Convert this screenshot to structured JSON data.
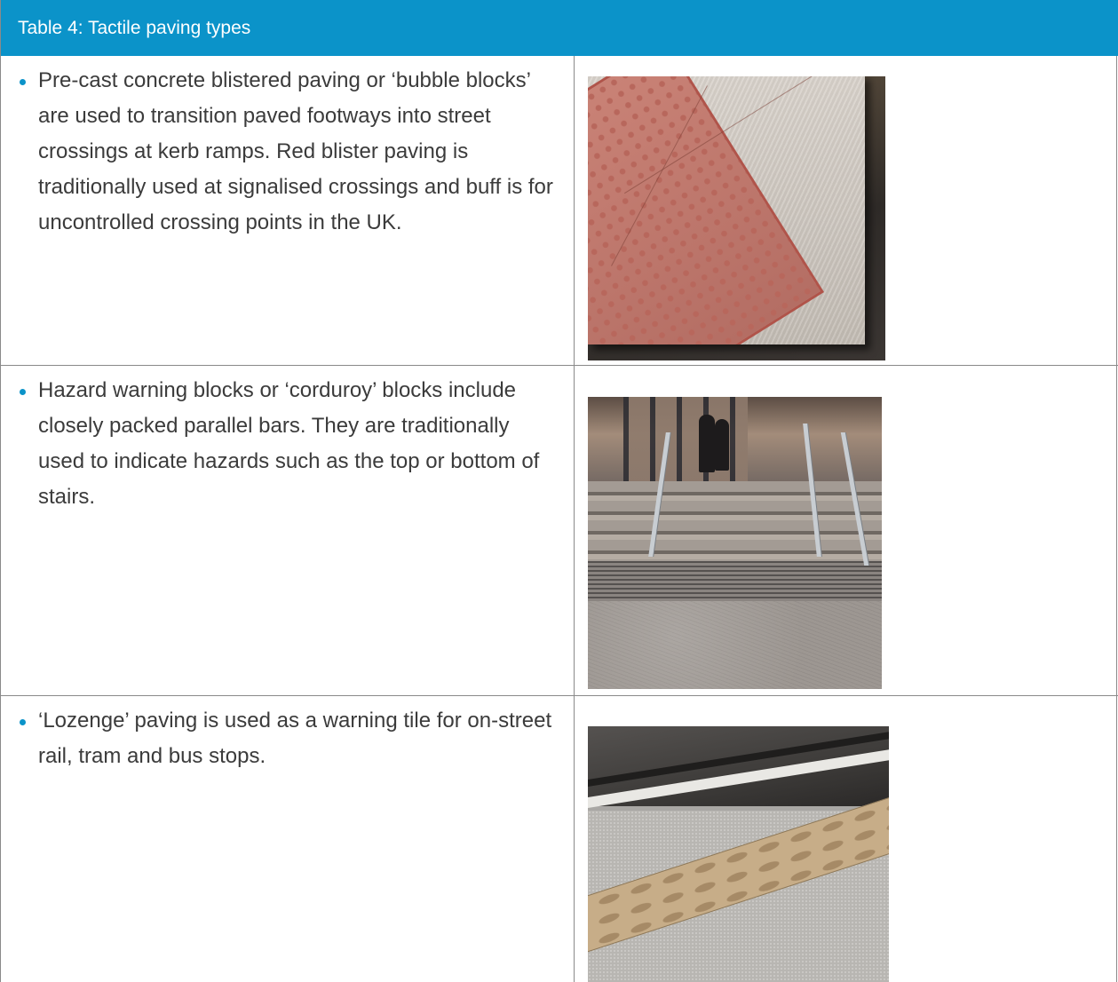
{
  "table": {
    "title": "Table 4: Tactile paving types",
    "rows": [
      {
        "text": "Pre-cast concrete blistered paving or ‘bubble blocks’ are used to transition paved footways into street crossings at kerb ramps. Red blister paving is traditionally used at signalised crossings and buff is for uncontrolled crossing points in the UK.",
        "image": "red-blister-paving-photo"
      },
      {
        "text": "Hazard warning blocks or ‘corduroy’ blocks include closely packed parallel bars. They are traditionally used to indicate hazards such as the top or bottom of stairs.",
        "image": "corduroy-steps-photo"
      },
      {
        "text": "‘Lozenge’ paving is used as a warning tile for on-street rail, tram and bus stops.",
        "image": "lozenge-paving-photo"
      }
    ]
  },
  "colors": {
    "header_bg": "#0b93c9",
    "bullet": "#0b93c9",
    "border": "#8a8a8a"
  }
}
